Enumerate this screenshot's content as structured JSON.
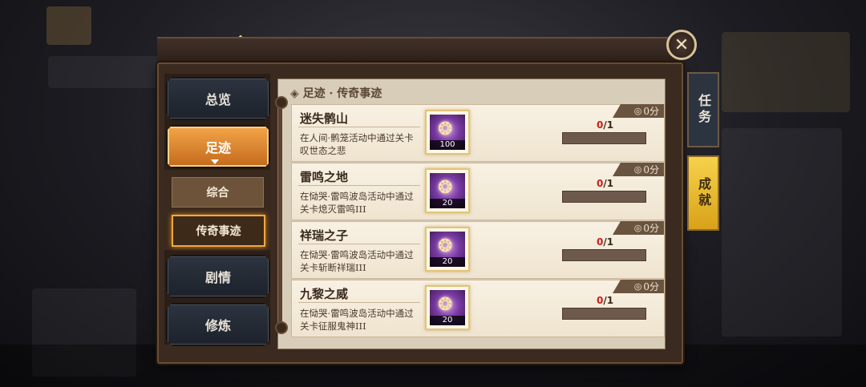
{
  "title": "成就",
  "help_label": "?",
  "close_label": "✕",
  "nav": {
    "overview": "总览",
    "footprint": "足迹",
    "sub_items": [
      "综合",
      "传奇事迹"
    ],
    "story": "剧情",
    "cultivation": "修炼"
  },
  "section_title": "足迹 · 传奇事迹",
  "section_marker": "◈",
  "achievements": [
    {
      "name": "迷失鹘山",
      "desc": "在人间·鹘笼活动中通过关卡叹世态之悲",
      "reward_count": "100",
      "score": "0分",
      "progress_current": "0",
      "progress_total": "/1",
      "progress_ratio": 0
    },
    {
      "name": "雷鸣之地",
      "desc": "在恸哭·雷鸣波岛活动中通过关卡熄灭雷鸣III",
      "reward_count": "20",
      "score": "0分",
      "progress_current": "0",
      "progress_total": "/1",
      "progress_ratio": 0
    },
    {
      "name": "祥瑞之子",
      "desc": "在恸哭·雷鸣波岛活动中通过关卡斩断祥瑞III",
      "reward_count": "20",
      "score": "0分",
      "progress_current": "0",
      "progress_total": "/1",
      "progress_ratio": 0
    },
    {
      "name": "九黎之威",
      "desc": "在恸哭·雷鸣波岛活动中通过关卡征服鬼神III",
      "reward_count": "20",
      "score": "0分",
      "progress_current": "0",
      "progress_total": "/1",
      "progress_ratio": 0
    }
  ],
  "side_tabs": {
    "tasks": "任务",
    "achievements": "成就"
  },
  "icons": {
    "score": "trophy-icon",
    "reward": "gem-icon"
  },
  "colors": {
    "accent": "#f0a840",
    "progress_red": "#c81e1e",
    "active_tab": "#e8b830"
  }
}
